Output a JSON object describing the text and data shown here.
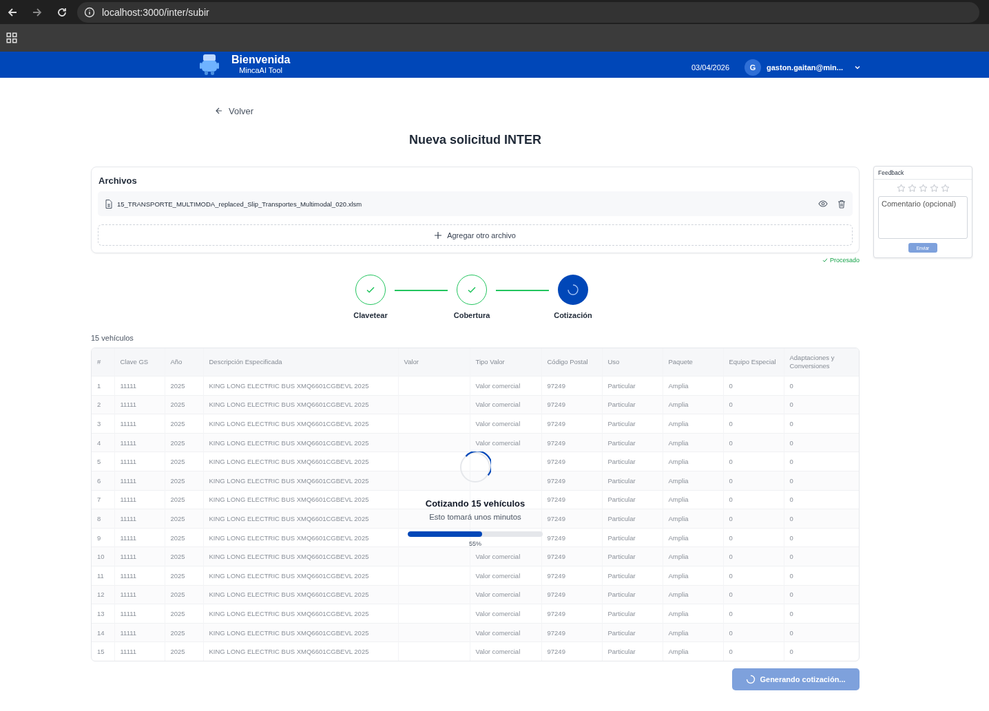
{
  "browser": {
    "url": "localhost:3000/inter/subir"
  },
  "header": {
    "title": "Bienvenida",
    "subtitle": "MincaAI Tool",
    "date": "03/04/2026",
    "avatar": "G",
    "user": "gaston.gaitan@min..."
  },
  "back": "Volver",
  "page_title": "Nueva solicitud INTER",
  "files": {
    "title": "Archivos",
    "items": [
      {
        "name": "15_TRANSPORTE_MULTIMODA_replaced_Slip_Transportes_Multimodal_020.xlsm"
      }
    ],
    "add": "Agregar otro archivo",
    "status": "Procesado"
  },
  "steps": [
    {
      "label": "Clavetear",
      "kind": "done"
    },
    {
      "label": "Cobertura",
      "kind": "done"
    },
    {
      "label": "Cotización",
      "kind": "active"
    }
  ],
  "table": {
    "count": "15 vehículos",
    "columns": [
      "#",
      "Clave GS",
      "Año",
      "Descripción Especificada",
      "Valor",
      "Tipo Valor",
      "Código Postal",
      "Uso",
      "Paquete",
      "Equipo Especial",
      "Adaptaciones y Conversiones"
    ],
    "rows": [
      {
        "number": "1",
        "clave_gs": "11111",
        "anio": "2025",
        "descripcion": "KING LONG ELECTRIC BUS XMQ6601CGBEVL 2025",
        "tipo_valor": "Valor comercial",
        "codigo_postal": "97249",
        "uso": "Particular",
        "paquete": "Amplia",
        "equipo_especial": "0",
        "adaptaciones": "0"
      },
      {
        "number": "2",
        "clave_gs": "11111",
        "anio": "2025",
        "descripcion": "KING LONG ELECTRIC BUS XMQ6601CGBEVL 2025",
        "tipo_valor": "Valor comercial",
        "codigo_postal": "97249",
        "uso": "Particular",
        "paquete": "Amplia",
        "equipo_especial": "0",
        "adaptaciones": "0"
      },
      {
        "number": "3",
        "clave_gs": "11111",
        "anio": "2025",
        "descripcion": "KING LONG ELECTRIC BUS XMQ6601CGBEVL 2025",
        "tipo_valor": "Valor comercial",
        "codigo_postal": "97249",
        "uso": "Particular",
        "paquete": "Amplia",
        "equipo_especial": "0",
        "adaptaciones": "0"
      },
      {
        "number": "4",
        "clave_gs": "11111",
        "anio": "2025",
        "descripcion": "KING LONG ELECTRIC BUS XMQ6601CGBEVL 2025",
        "tipo_valor": "Valor comercial",
        "codigo_postal": "97249",
        "uso": "Particular",
        "paquete": "Amplia",
        "equipo_especial": "0",
        "adaptaciones": "0"
      },
      {
        "number": "5",
        "clave_gs": "11111",
        "anio": "2025",
        "descripcion": "KING LONG ELECTRIC BUS XMQ6601CGBEVL 2025",
        "codigo_postal": "97249",
        "uso": "Particular",
        "paquete": "Amplia",
        "equipo_especial": "0",
        "adaptaciones": "0"
      },
      {
        "number": "6",
        "clave_gs": "11111",
        "anio": "2025",
        "descripcion": "KING LONG ELECTRIC BUS XMQ6601CGBEVL 2025",
        "codigo_postal": "97249",
        "uso": "Particular",
        "paquete": "Amplia",
        "equipo_especial": "0",
        "adaptaciones": "0"
      },
      {
        "number": "7",
        "clave_gs": "11111",
        "anio": "2025",
        "descripcion": "KING LONG ELECTRIC BUS XMQ6601CGBEVL 2025",
        "codigo_postal": "97249",
        "uso": "Particular",
        "paquete": "Amplia",
        "equipo_especial": "0",
        "adaptaciones": "0"
      },
      {
        "number": "8",
        "clave_gs": "11111",
        "anio": "2025",
        "descripcion": "KING LONG ELECTRIC BUS XMQ6601CGBEVL 2025",
        "codigo_postal": "97249",
        "uso": "Particular",
        "paquete": "Amplia",
        "equipo_especial": "0",
        "adaptaciones": "0"
      },
      {
        "number": "9",
        "clave_gs": "11111",
        "anio": "2025",
        "descripcion": "KING LONG ELECTRIC BUS XMQ6601CGBEVL 2025",
        "codigo_postal": "97249",
        "uso": "Particular",
        "paquete": "Amplia",
        "equipo_especial": "0",
        "adaptaciones": "0"
      },
      {
        "number": "10",
        "clave_gs": "11111",
        "anio": "2025",
        "descripcion": "KING LONG ELECTRIC BUS XMQ6601CGBEVL 2025",
        "tipo_valor": "Valor comercial",
        "codigo_postal": "97249",
        "uso": "Particular",
        "paquete": "Amplia",
        "equipo_especial": "0",
        "adaptaciones": "0"
      },
      {
        "number": "11",
        "clave_gs": "11111",
        "anio": "2025",
        "descripcion": "KING LONG ELECTRIC BUS XMQ6601CGBEVL 2025",
        "tipo_valor": "Valor comercial",
        "codigo_postal": "97249",
        "uso": "Particular",
        "paquete": "Amplia",
        "equipo_especial": "0",
        "adaptaciones": "0"
      },
      {
        "number": "12",
        "clave_gs": "11111",
        "anio": "2025",
        "descripcion": "KING LONG ELECTRIC BUS XMQ6601CGBEVL 2025",
        "tipo_valor": "Valor comercial",
        "codigo_postal": "97249",
        "uso": "Particular",
        "paquete": "Amplia",
        "equipo_especial": "0",
        "adaptaciones": "0"
      },
      {
        "number": "13",
        "clave_gs": "11111",
        "anio": "2025",
        "descripcion": "KING LONG ELECTRIC BUS XMQ6601CGBEVL 2025",
        "tipo_valor": "Valor comercial",
        "codigo_postal": "97249",
        "uso": "Particular",
        "paquete": "Amplia",
        "equipo_especial": "0",
        "adaptaciones": "0"
      },
      {
        "number": "14",
        "clave_gs": "11111",
        "anio": "2025",
        "descripcion": "KING LONG ELECTRIC BUS XMQ6601CGBEVL 2025",
        "tipo_valor": "Valor comercial",
        "codigo_postal": "97249",
        "uso": "Particular",
        "paquete": "Amplia",
        "equipo_especial": "0",
        "adaptaciones": "0"
      },
      {
        "number": "15",
        "clave_gs": "11111",
        "anio": "2025",
        "descripcion": "KING LONG ELECTRIC BUS XMQ6601CGBEVL 2025",
        "tipo_valor": "Valor comercial",
        "codigo_postal": "97249",
        "uso": "Particular",
        "paquete": "Amplia",
        "equipo_especial": "0",
        "adaptaciones": "0"
      }
    ]
  },
  "progress": {
    "title": "Cotizando 15 vehículos",
    "subtitle": "Esto tomará unos minutos",
    "level": 0.55,
    "reading": "55%"
  },
  "submit": {
    "label": "Generando cotización...",
    "disabled": true
  },
  "feedback": {
    "title": "Feedback",
    "stars": 0,
    "placeholder": "Comentario (opcional)",
    "button": {
      "label": "Enviar",
      "disabled": true
    }
  }
}
